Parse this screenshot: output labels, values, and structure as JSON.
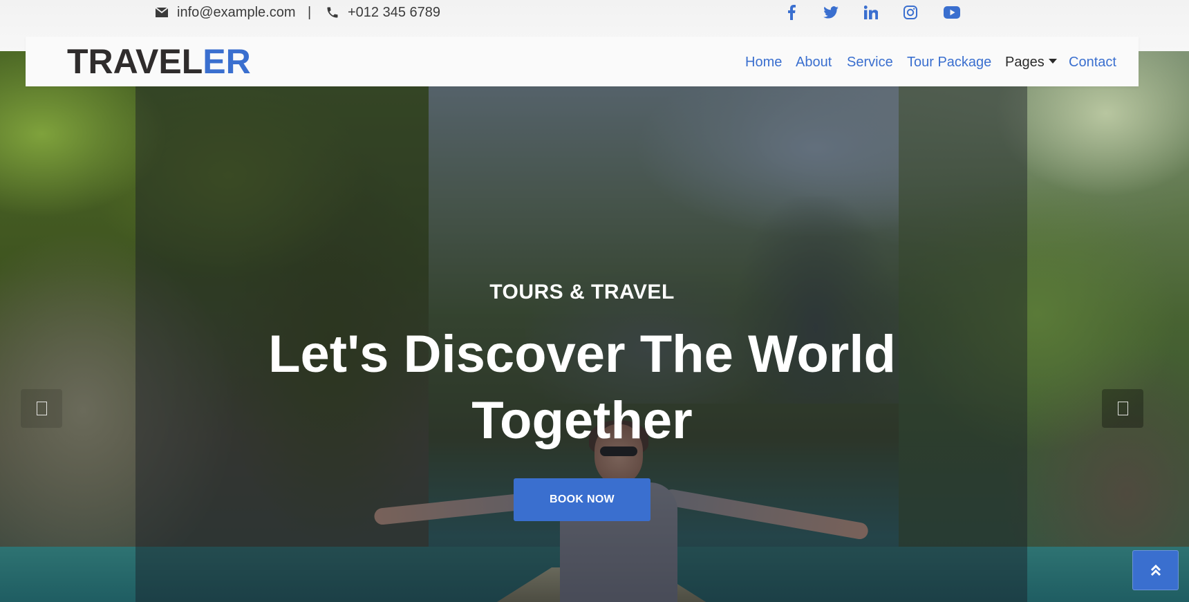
{
  "topbar": {
    "email": "info@example.com",
    "separator": "|",
    "phone": "+012 345 6789",
    "social_icons": [
      "facebook-icon",
      "twitter-icon",
      "linkedin-icon",
      "instagram-icon",
      "youtube-icon"
    ]
  },
  "navbar": {
    "logo_main": "TRAVEL",
    "logo_accent": "ER",
    "links": [
      {
        "label": "Home"
      },
      {
        "label": "About"
      },
      {
        "label": "Service"
      },
      {
        "label": "Tour Package"
      },
      {
        "label": "Pages"
      },
      {
        "label": "Contact"
      }
    ]
  },
  "hero": {
    "eyebrow": "TOURS & TRAVEL",
    "headline": "Let's Discover The World Together",
    "button": "BOOK NOW"
  },
  "colors": {
    "accent": "#3a6fcf",
    "text_dark": "#2f2c2c"
  }
}
